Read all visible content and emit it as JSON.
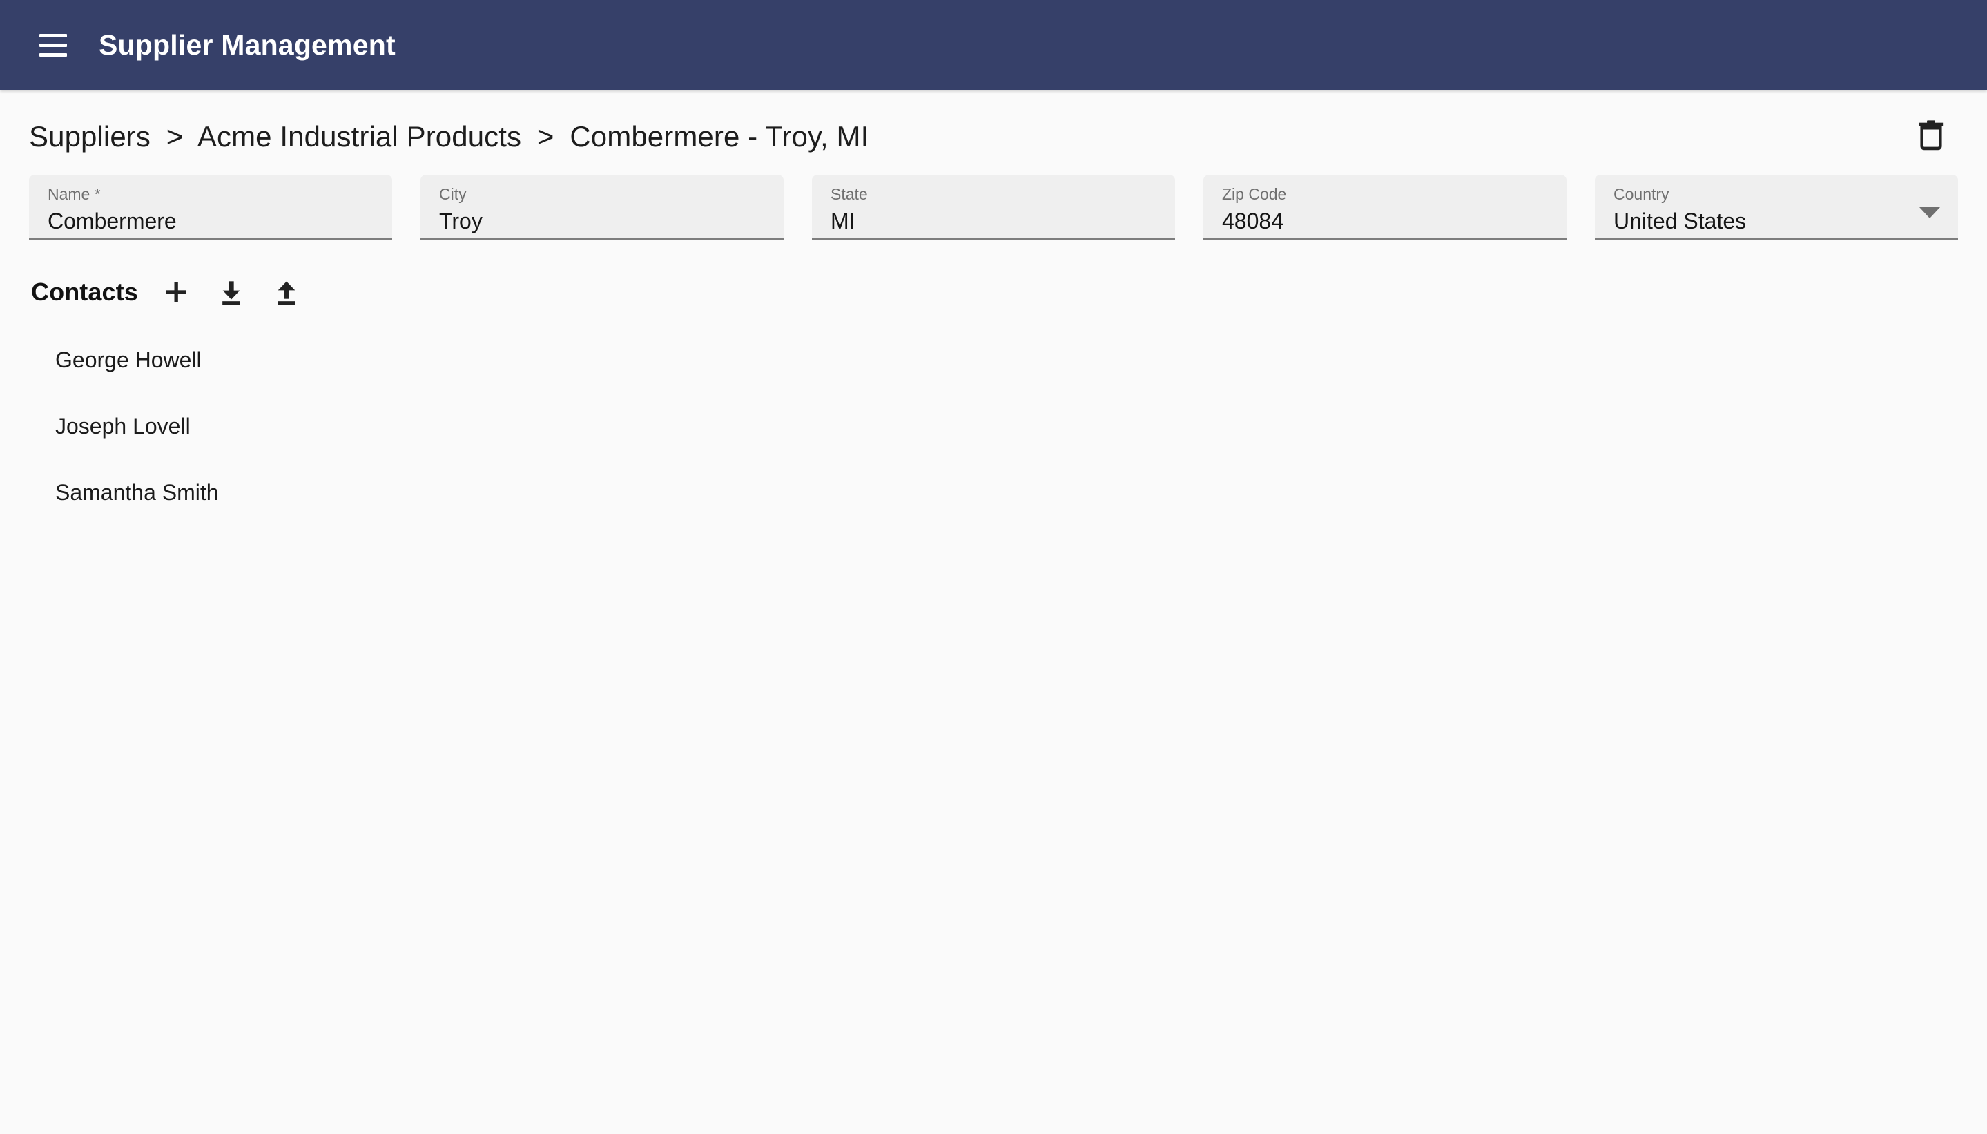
{
  "appbar": {
    "title": "Supplier Management",
    "menu_label": "menu",
    "background": "#364069"
  },
  "breadcrumb": {
    "separator": ">",
    "items": [
      {
        "label": "Suppliers"
      },
      {
        "label": "Acme Industrial Products"
      },
      {
        "label": "Combermere - Troy, MI"
      }
    ]
  },
  "toolbar": {
    "delete_label": "Delete"
  },
  "form": {
    "fields": [
      {
        "label": "Name *",
        "value": "Combermere",
        "placeholder": "Name",
        "type": "text"
      },
      {
        "label": "City",
        "value": "Troy",
        "placeholder": "City",
        "type": "text"
      },
      {
        "label": "State",
        "value": "MI",
        "placeholder": "State",
        "type": "text"
      },
      {
        "label": "Zip Code",
        "value": "48084",
        "placeholder": "Zip Code",
        "type": "text"
      },
      {
        "label": "Country",
        "value": "United States",
        "placeholder": "Country",
        "type": "select"
      }
    ]
  },
  "contacts": {
    "title": "Contacts",
    "actions": [
      {
        "name": "add",
        "label": "Add contact"
      },
      {
        "name": "download",
        "label": "Download contacts"
      },
      {
        "name": "upload",
        "label": "Upload contacts"
      }
    ],
    "items": [
      {
        "name": "George Howell"
      },
      {
        "name": "Joseph Lovell"
      },
      {
        "name": "Samantha Smith"
      }
    ]
  },
  "colors": {
    "appbar": "#364069",
    "page_background": "#fafafa",
    "field_background": "#efefef",
    "field_underline": "#7d7d7d",
    "text_primary": "#1b1b1b",
    "text_secondary": "#707070"
  }
}
